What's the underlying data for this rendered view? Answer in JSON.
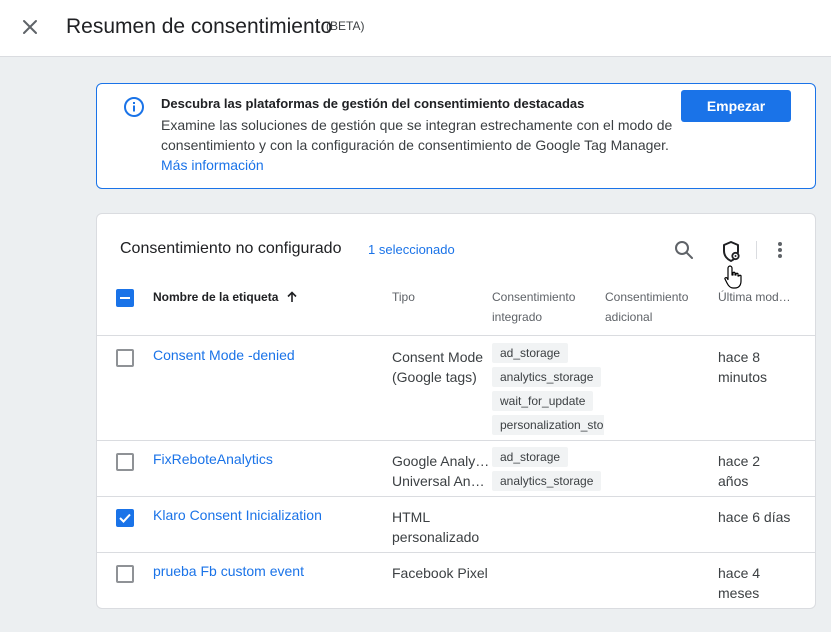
{
  "header": {
    "title": "Resumen de consentimiento",
    "beta": "(BETA)"
  },
  "banner": {
    "title": "Descubra las plataformas de gestión del consentimiento destacadas",
    "body": "Examine las soluciones de gestión que se integran estrechamente con el modo de consentimiento y con la configuración de consentimiento de Google Tag Manager.",
    "link": "Más información",
    "button": "Empezar"
  },
  "table": {
    "title": "Consentimiento no configurado",
    "selected": "1 seleccionado",
    "columns": {
      "name": "Nombre de la etiqueta",
      "type": "Tipo",
      "consent_builtin": [
        "Consentimiento",
        "integrado"
      ],
      "consent_extra": [
        "Consentimiento",
        "adicional"
      ],
      "modified": "Última mod…"
    },
    "rows": [
      {
        "name": "Consent Mode -denied",
        "type": [
          "Consent Mode",
          "(Google tags)"
        ],
        "chips": [
          "ad_storage",
          "analytics_storage",
          "wait_for_update",
          "personalization_storage"
        ],
        "modified": [
          "hace 8",
          "minutos"
        ],
        "checked": false
      },
      {
        "name": "FixReboteAnalytics",
        "type": [
          "Google Analytics",
          "Universal Analytics"
        ],
        "chips": [
          "ad_storage",
          "analytics_storage"
        ],
        "modified": [
          "hace 2",
          "años"
        ],
        "checked": false
      },
      {
        "name": "Klaro Consent Inicialization",
        "type": [
          "HTML",
          "personalizado"
        ],
        "chips": [],
        "modified": [
          "hace 6 días"
        ],
        "checked": true
      },
      {
        "name": "prueba Fb custom event",
        "type": [
          "Facebook Pixel"
        ],
        "chips": [],
        "modified": [
          "hace 4",
          "meses"
        ],
        "checked": false
      }
    ]
  },
  "icons": {
    "close": "close-icon",
    "info": "info-icon",
    "search": "search-icon",
    "consent_settings": "shield-gear-icon",
    "more": "more-vert-icon",
    "sort": "arrow-up-icon",
    "cursor": "hand-pointer-icon"
  },
  "colors": {
    "accent": "#1a73e8",
    "background": "#eceff1",
    "chip": "#f1f3f4"
  }
}
